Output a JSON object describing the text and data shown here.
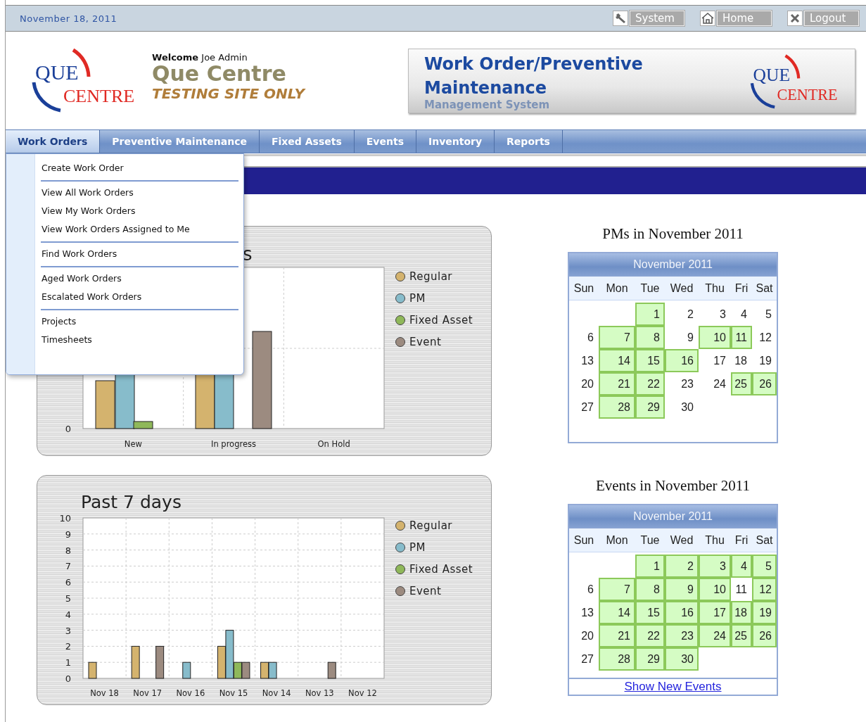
{
  "date": "November 18, 2011",
  "top_buttons": [
    {
      "kind": "wrench",
      "label": "System"
    },
    {
      "kind": "house",
      "label": "Home"
    },
    {
      "kind": "x",
      "label": "Logout"
    }
  ],
  "logo": {
    "line1": "QUE",
    "line2": "CENTRE"
  },
  "welcome": {
    "label": "Welcome",
    "user": "Joe Admin"
  },
  "site_name": "Que Centre",
  "site_note": "TESTING SITE ONLY",
  "banner": {
    "title": "Work Order/Preventive Maintenance",
    "subtitle": "Management System",
    "logo": {
      "line1": "QUE",
      "line2": "CENTRE"
    }
  },
  "nav_tabs": [
    {
      "label": "Work Orders",
      "selected": true
    },
    {
      "label": "Preventive Maintenance",
      "selected": false
    },
    {
      "label": "Fixed Assets",
      "selected": false
    },
    {
      "label": "Events",
      "selected": false
    },
    {
      "label": "Inventory",
      "selected": false
    },
    {
      "label": "Reports",
      "selected": false
    }
  ],
  "menu": {
    "groups": [
      [
        "Create Work Order"
      ],
      [
        "View All Work Orders",
        "View My Work Orders",
        "View Work Orders Assigned to Me"
      ],
      [
        "Find Work Orders"
      ],
      [
        "Aged Work Orders",
        "Escalated Work Orders"
      ],
      [
        "Projects",
        "Timesheets"
      ]
    ]
  },
  "status_chart": {
    "title_visible": "s",
    "y_tick": "0",
    "categories": [
      "New",
      "In progress",
      "On Hold"
    ]
  },
  "legend": [
    {
      "label": "Regular",
      "color": "#d4b36e"
    },
    {
      "label": "PM",
      "color": "#87bccb"
    },
    {
      "label": "Fixed Asset",
      "color": "#8fb85a"
    },
    {
      "label": "Event",
      "color": "#9c8b80"
    }
  ],
  "week_chart": {
    "chart_data": {
      "type": "bar",
      "title": "Past 7 days",
      "grid": true,
      "legend": "right",
      "categories": [
        "Nov 18",
        "Nov 17",
        "Nov 16",
        "Nov 15",
        "Nov 14",
        "Nov 13",
        "Nov 12"
      ],
      "ylim": [
        0,
        10
      ],
      "yticks": [
        0,
        1,
        2,
        3,
        4,
        5,
        6,
        7,
        8,
        9,
        10
      ],
      "series": [
        {
          "name": "Regular",
          "color": "#d4b36e",
          "values": [
            1,
            2,
            0,
            2,
            1,
            0,
            0
          ]
        },
        {
          "name": "PM",
          "color": "#87bccb",
          "values": [
            0,
            0,
            1,
            3,
            1,
            0,
            0
          ]
        },
        {
          "name": "Fixed Asset",
          "color": "#8fb85a",
          "values": [
            0,
            0,
            0,
            1,
            0,
            0,
            0
          ]
        },
        {
          "name": "Event",
          "color": "#9c8b80",
          "values": [
            0,
            2,
            0,
            1,
            0,
            1,
            0
          ]
        }
      ]
    }
  },
  "calendars": [
    {
      "heading": "PMs in November 2011",
      "month": "November 2011",
      "weekdays": [
        "Sun",
        "Mon",
        "Tue",
        "Wed",
        "Thu",
        "Fri",
        "Sat"
      ],
      "weeks": [
        [
          {
            "day": "1",
            "marked": true
          },
          {
            "day": "2",
            "marked": false
          },
          {
            "day": "3",
            "marked": false
          },
          {
            "day": "4",
            "marked": false
          },
          {
            "day": "5",
            "marked": false
          }
        ],
        [
          {
            "day": "6",
            "marked": false
          },
          {
            "day": "7",
            "marked": true
          },
          {
            "day": "8",
            "marked": true
          },
          {
            "day": "9",
            "marked": false
          },
          {
            "day": "10",
            "marked": true
          },
          {
            "day": "11",
            "marked": true
          },
          {
            "day": "12",
            "marked": false
          }
        ],
        [
          {
            "day": "13",
            "marked": false
          },
          {
            "day": "14",
            "marked": true
          },
          {
            "day": "15",
            "marked": true
          },
          {
            "day": "16",
            "marked": true
          },
          {
            "day": "17",
            "marked": false
          },
          {
            "day": "18",
            "marked": false
          },
          {
            "day": "19",
            "marked": false
          }
        ],
        [
          {
            "day": "20",
            "marked": false
          },
          {
            "day": "21",
            "marked": true
          },
          {
            "day": "22",
            "marked": true
          },
          {
            "day": "23",
            "marked": false
          },
          {
            "day": "24",
            "marked": false
          },
          {
            "day": "25",
            "marked": true
          },
          {
            "day": "26",
            "marked": true
          }
        ],
        [
          {
            "day": "27",
            "marked": false
          },
          {
            "day": "28",
            "marked": true
          },
          {
            "day": "29",
            "marked": true
          },
          {
            "day": "30",
            "marked": false
          }
        ]
      ]
    },
    {
      "heading": "Events in November 2011",
      "month": "November 2011",
      "weekdays": [
        "Sun",
        "Mon",
        "Tue",
        "Wed",
        "Thu",
        "Fri",
        "Sat"
      ],
      "link": "Show New Events",
      "weeks": [
        [
          {
            "day": "1",
            "marked": true
          },
          {
            "day": "2",
            "marked": true
          },
          {
            "day": "3",
            "marked": true
          },
          {
            "day": "4",
            "marked": true
          },
          {
            "day": "5",
            "marked": true
          }
        ],
        [
          {
            "day": "6",
            "marked": false
          },
          {
            "day": "7",
            "marked": true
          },
          {
            "day": "8",
            "marked": true
          },
          {
            "day": "9",
            "marked": true
          },
          {
            "day": "10",
            "marked": true
          },
          {
            "day": "11",
            "marked": false
          },
          {
            "day": "12",
            "marked": true
          }
        ],
        [
          {
            "day": "13",
            "marked": false
          },
          {
            "day": "14",
            "marked": true
          },
          {
            "day": "15",
            "marked": true
          },
          {
            "day": "16",
            "marked": true
          },
          {
            "day": "17",
            "marked": true
          },
          {
            "day": "18",
            "marked": true
          },
          {
            "day": "19",
            "marked": true
          }
        ],
        [
          {
            "day": "20",
            "marked": false
          },
          {
            "day": "21",
            "marked": true
          },
          {
            "day": "22",
            "marked": true
          },
          {
            "day": "23",
            "marked": true
          },
          {
            "day": "24",
            "marked": true
          },
          {
            "day": "25",
            "marked": true
          },
          {
            "day": "26",
            "marked": true
          }
        ],
        [
          {
            "day": "27",
            "marked": false
          },
          {
            "day": "28",
            "marked": true
          },
          {
            "day": "29",
            "marked": true
          },
          {
            "day": "30",
            "marked": true
          }
        ]
      ]
    }
  ]
}
